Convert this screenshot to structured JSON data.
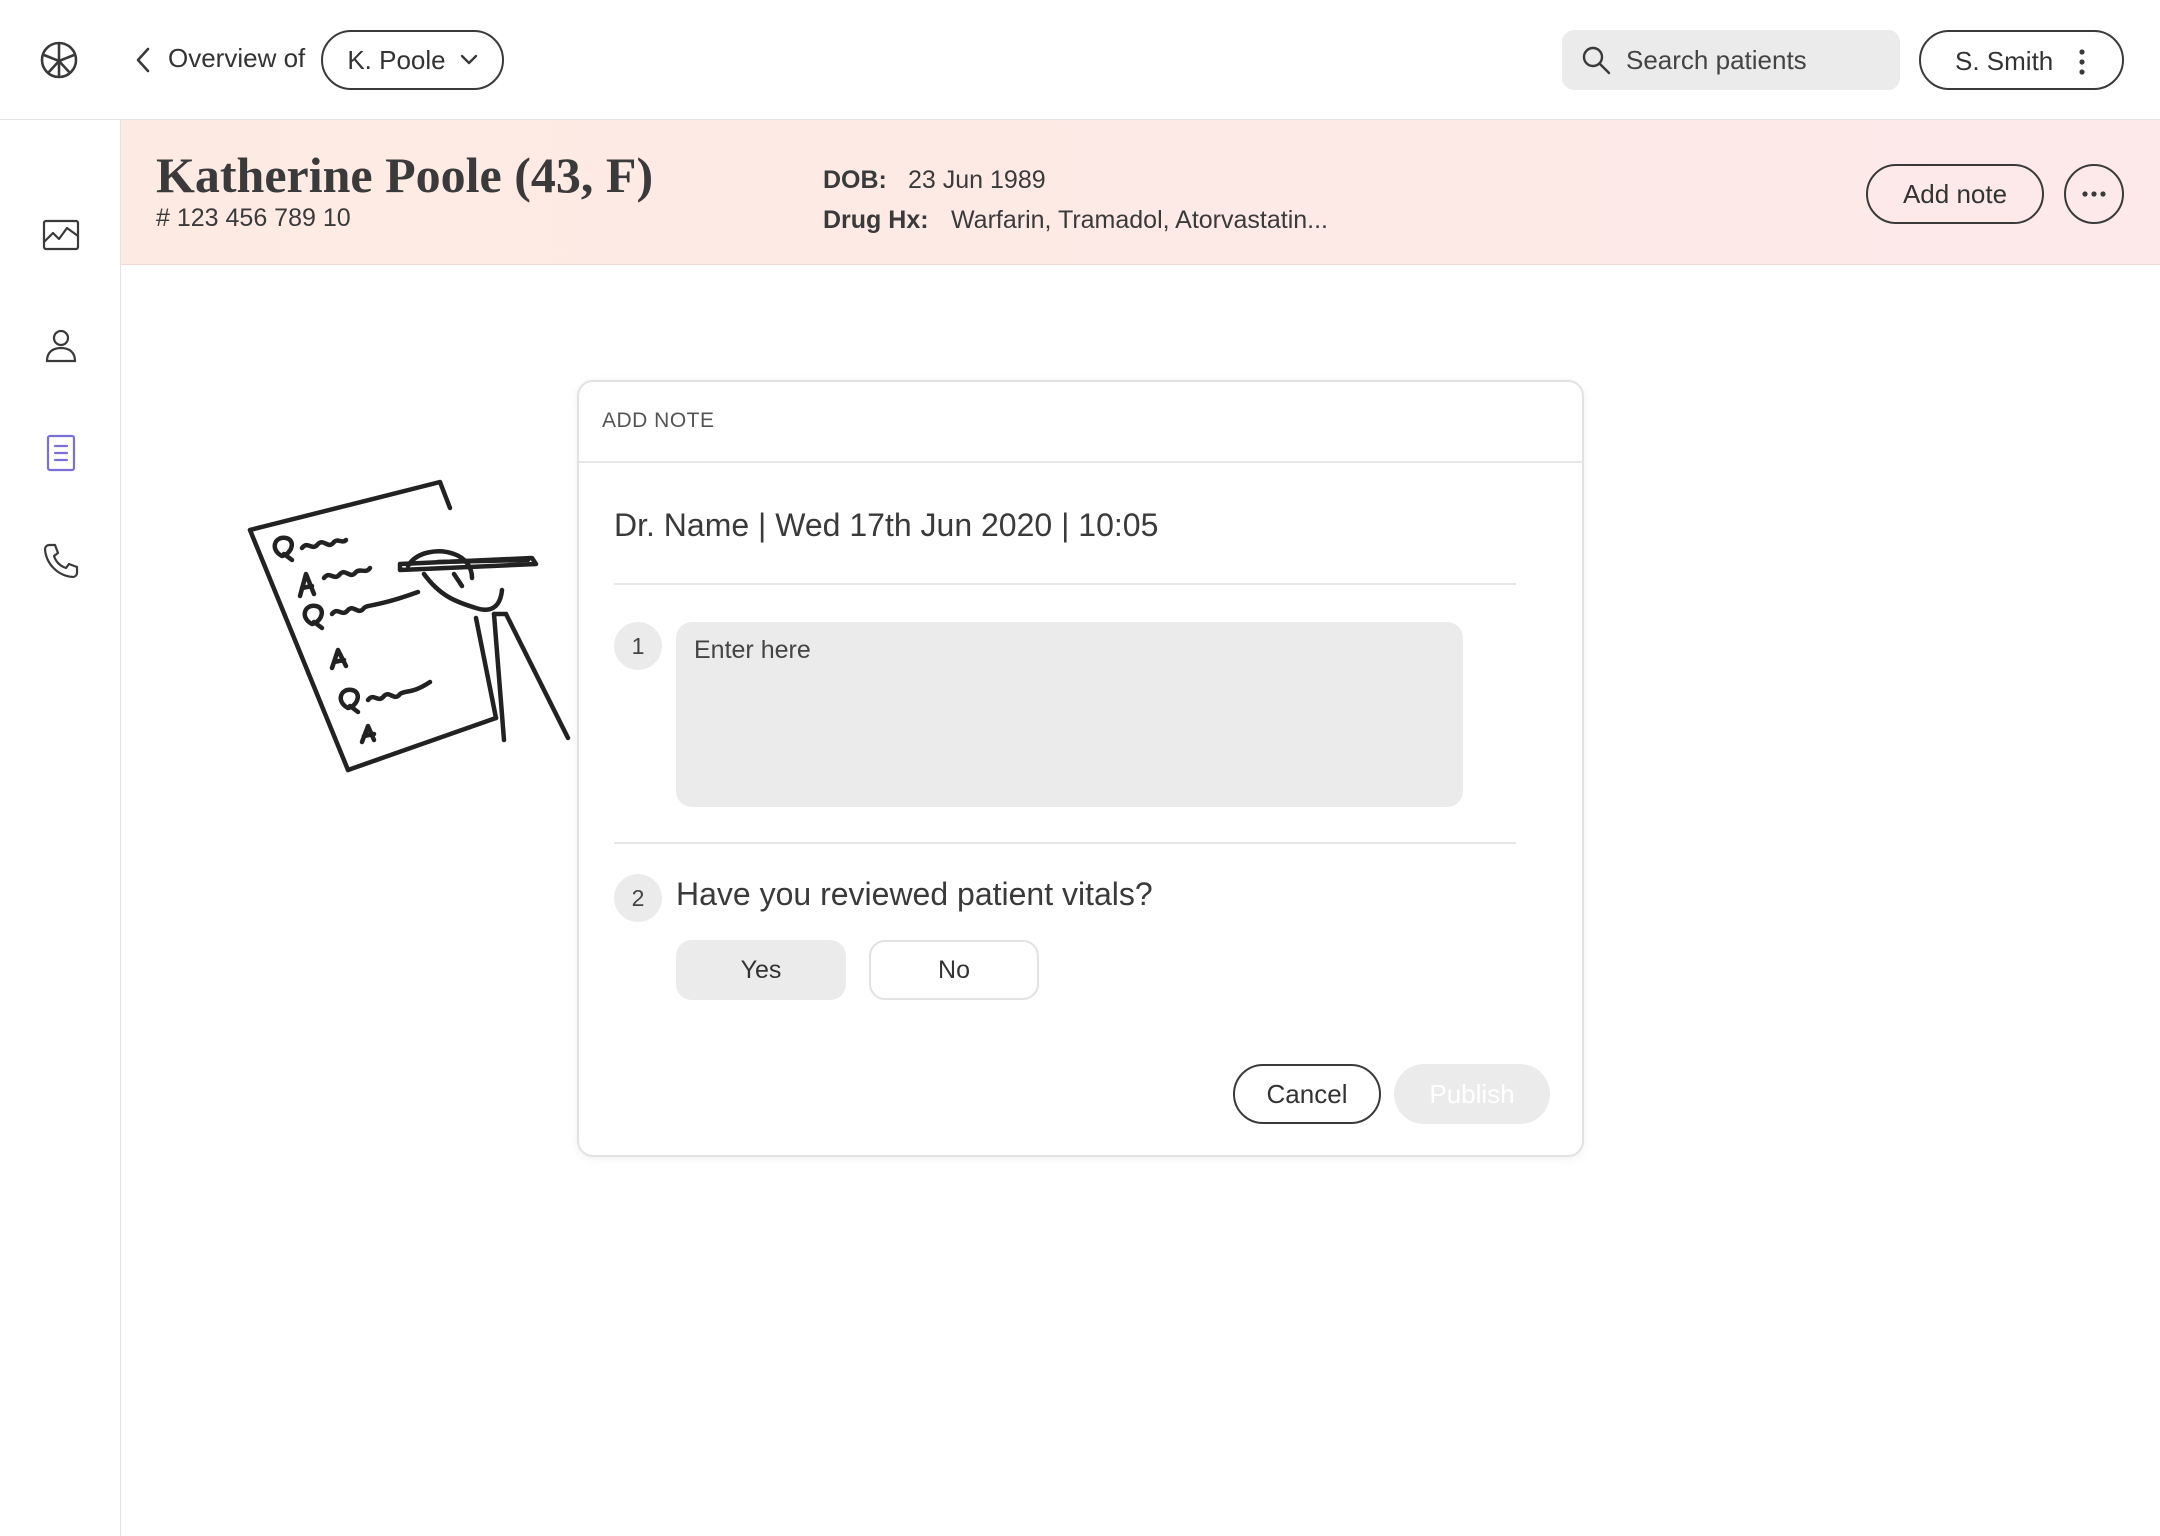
{
  "topbar": {
    "breadcrumb_label": "Overview of",
    "patient_select_value": "K. Poole",
    "search_placeholder": "Search patients",
    "user_name": "S. Smith"
  },
  "sidebar": {
    "items": [
      {
        "icon": "chart-icon"
      },
      {
        "icon": "person-icon"
      },
      {
        "icon": "notes-icon",
        "active": true,
        "active_color": "#7b6fd8"
      },
      {
        "icon": "phone-icon"
      }
    ]
  },
  "patient": {
    "name": "Katherine Poole (43, F)",
    "id": "# 123 456 789 10",
    "dob_label": "DOB:",
    "dob": "23 Jun 1989",
    "drug_label": "Drug Hx:",
    "drugs": "Warfarin, Tramadol, Atorvastatin...",
    "add_note_label": "Add note"
  },
  "modal": {
    "title": "ADD NOTE",
    "meta": "Dr. Name | Wed 17th Jun 2020 | 10:05",
    "step1_number": "1",
    "note_placeholder": "Enter here",
    "step2_number": "2",
    "question": "Have you reviewed patient vitals?",
    "yes_label": "Yes",
    "no_label": "No",
    "selected_answer": "Yes",
    "cancel_label": "Cancel",
    "publish_label": "Publish"
  },
  "colors": {
    "banner_start": "#fdebe3",
    "banner_end": "#fde9ea",
    "accent": "#7b6fd8",
    "text": "#3a3a3a",
    "field_bg": "#ebebeb"
  }
}
